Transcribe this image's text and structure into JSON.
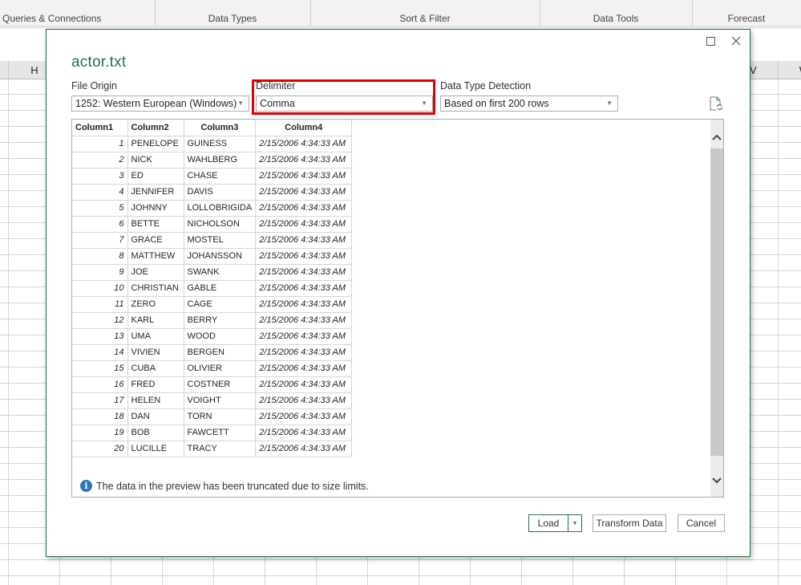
{
  "ribbon": {
    "groups": [
      {
        "label": "Queries & Connections"
      },
      {
        "label": "Data Types"
      },
      {
        "label": "Sort & Filter"
      },
      {
        "label": "Data Tools"
      },
      {
        "label": "Forecast"
      }
    ]
  },
  "sheet": {
    "visible_columns": [
      "H",
      "V",
      "W"
    ]
  },
  "dialog": {
    "title": "actor.txt",
    "file_origin": {
      "label": "File Origin",
      "value": "1252: Western European (Windows)"
    },
    "delimiter": {
      "label": "Delimiter",
      "value": "Comma"
    },
    "data_type_detection": {
      "label": "Data Type Detection",
      "value": "Based on first 200 rows"
    },
    "preview": {
      "columns": [
        "Column1",
        "Column2",
        "Column3",
        "Column4"
      ],
      "rows": [
        [
          "1",
          "PENELOPE",
          "GUINESS",
          "2/15/2006 4:34:33 AM"
        ],
        [
          "2",
          "NICK",
          "WAHLBERG",
          "2/15/2006 4:34:33 AM"
        ],
        [
          "3",
          "ED",
          "CHASE",
          "2/15/2006 4:34:33 AM"
        ],
        [
          "4",
          "JENNIFER",
          "DAVIS",
          "2/15/2006 4:34:33 AM"
        ],
        [
          "5",
          "JOHNNY",
          "LOLLOBRIGIDA",
          "2/15/2006 4:34:33 AM"
        ],
        [
          "6",
          "BETTE",
          "NICHOLSON",
          "2/15/2006 4:34:33 AM"
        ],
        [
          "7",
          "GRACE",
          "MOSTEL",
          "2/15/2006 4:34:33 AM"
        ],
        [
          "8",
          "MATTHEW",
          "JOHANSSON",
          "2/15/2006 4:34:33 AM"
        ],
        [
          "9",
          "JOE",
          "SWANK",
          "2/15/2006 4:34:33 AM"
        ],
        [
          "10",
          "CHRISTIAN",
          "GABLE",
          "2/15/2006 4:34:33 AM"
        ],
        [
          "11",
          "ZERO",
          "CAGE",
          "2/15/2006 4:34:33 AM"
        ],
        [
          "12",
          "KARL",
          "BERRY",
          "2/15/2006 4:34:33 AM"
        ],
        [
          "13",
          "UMA",
          "WOOD",
          "2/15/2006 4:34:33 AM"
        ],
        [
          "14",
          "VIVIEN",
          "BERGEN",
          "2/15/2006 4:34:33 AM"
        ],
        [
          "15",
          "CUBA",
          "OLIVIER",
          "2/15/2006 4:34:33 AM"
        ],
        [
          "16",
          "FRED",
          "COSTNER",
          "2/15/2006 4:34:33 AM"
        ],
        [
          "17",
          "HELEN",
          "VOIGHT",
          "2/15/2006 4:34:33 AM"
        ],
        [
          "18",
          "DAN",
          "TORN",
          "2/15/2006 4:34:33 AM"
        ],
        [
          "19",
          "BOB",
          "FAWCETT",
          "2/15/2006 4:34:33 AM"
        ],
        [
          "20",
          "LUCILLE",
          "TRACY",
          "2/15/2006 4:34:33 AM"
        ]
      ],
      "notice": "The data in the preview has been truncated due to size limits."
    },
    "buttons": {
      "load": "Load",
      "transform": "Transform Data",
      "cancel": "Cancel"
    },
    "icons": {
      "maximize": "maximize-icon",
      "close": "close-icon",
      "refresh": "refresh-file-icon",
      "info": "info-icon",
      "scroll_up": "chevron-up-icon",
      "scroll_down": "chevron-down-icon"
    },
    "colors": {
      "accent": "#217346",
      "highlight": "#e00000",
      "info": "#2b75c0"
    }
  }
}
